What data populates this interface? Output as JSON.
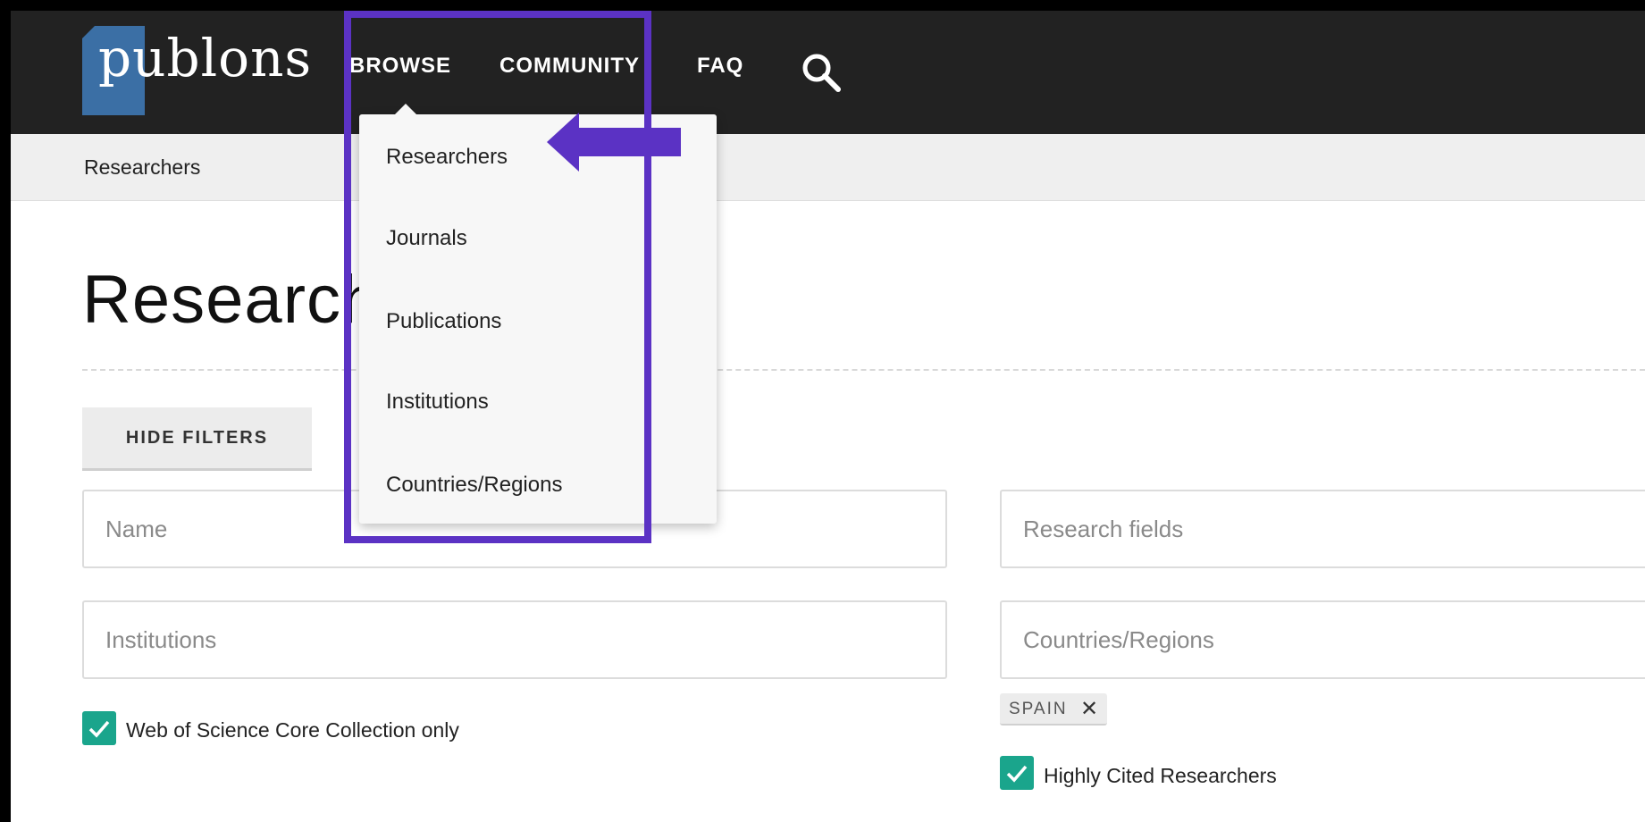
{
  "header": {
    "logo_text": "publons",
    "nav": {
      "browse": "BROWSE",
      "community": "COMMUNITY",
      "faq": "FAQ"
    },
    "search_icon": "search-icon"
  },
  "breadcrumb": "Researchers",
  "main": {
    "title": "Researchers",
    "hide_filters_label": "HIDE FILTERS",
    "filters": {
      "name_placeholder": "Name",
      "institutions_placeholder": "Institutions",
      "research_fields_placeholder": "Research fields",
      "countries_placeholder": "Countries/Regions",
      "selected_country_tag": "SPAIN",
      "wos_only_label": "Web of Science Core Collection only",
      "wos_only_checked": true,
      "highly_cited_label": "Highly Cited Researchers",
      "highly_cited_checked": true
    }
  },
  "browse_menu": {
    "items": [
      "Researchers",
      "Journals",
      "Publications",
      "Institutions",
      "Countries/Regions"
    ]
  },
  "colors": {
    "header_bg": "#222222",
    "logo_blue": "#3b6fa5",
    "accent_check": "#1aa58c",
    "annotation_purple": "#5b32c4"
  }
}
